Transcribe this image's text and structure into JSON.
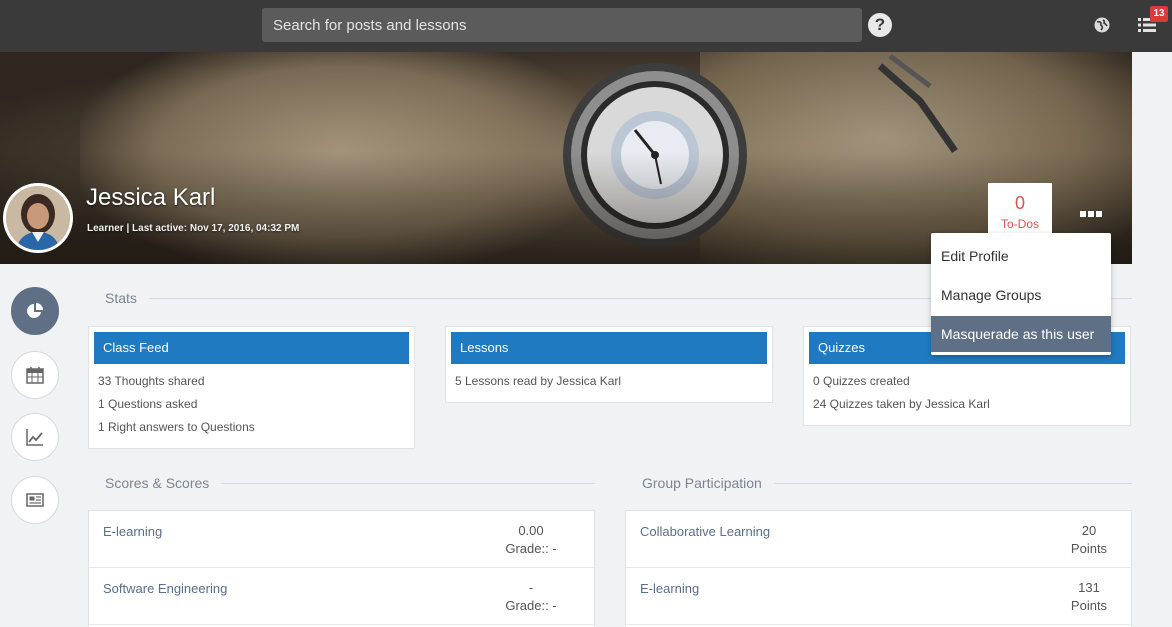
{
  "search": {
    "placeholder": "Search for posts and lessons"
  },
  "header": {
    "notification_count": "13",
    "icons": [
      "help-icon",
      "globe-icon",
      "notifications-icon"
    ]
  },
  "profile": {
    "name": "Jessica Karl",
    "meta": "Learner | Last active: Nov 17, 2016, 04:32 PM",
    "todos_count": "0",
    "todos_label": "To-Dos"
  },
  "menu": {
    "items": [
      {
        "label": "Edit Profile"
      },
      {
        "label": "Manage Groups"
      },
      {
        "label": "Masquerade as this user"
      }
    ]
  },
  "sidebar": {
    "icons": [
      "pie-chart-icon",
      "calendar-icon",
      "line-chart-icon",
      "newspaper-icon"
    ]
  },
  "stats": {
    "label": "Stats",
    "cards": [
      {
        "title": "Class Feed",
        "lines": [
          "33 Thoughts shared",
          "1 Questions asked",
          "1 Right answers to Questions"
        ]
      },
      {
        "title": "Lessons",
        "lines": [
          "5 Lessons read by Jessica Karl"
        ]
      },
      {
        "title": "Quizzes",
        "lines": [
          "0 Quizzes created",
          "24 Quizzes taken by Jessica Karl"
        ]
      }
    ]
  },
  "scores": {
    "label": "Scores & Scores",
    "rows": [
      {
        "name": "E-learning",
        "value": "0.00",
        "sub": "Grade:: -"
      },
      {
        "name": "Software Engineering",
        "value": "-",
        "sub": "Grade:: -"
      }
    ]
  },
  "participation": {
    "label": "Group Participation",
    "rows": [
      {
        "name": "Collaborative Learning",
        "value": "20",
        "sub": "Points"
      },
      {
        "name": "E-learning",
        "value": "131",
        "sub": "Points"
      }
    ]
  },
  "colors": {
    "accent": "#1f7ac2",
    "active": "#5f6f86",
    "alert": "#d9534f",
    "topbar": "#3a3a3a"
  }
}
